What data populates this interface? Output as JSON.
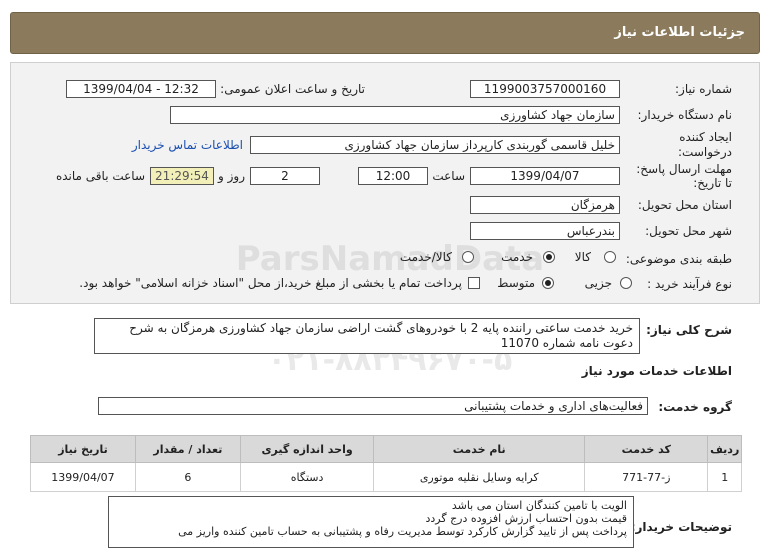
{
  "header": {
    "title": "جزئیات اطلاعات نیاز"
  },
  "form": {
    "need_number_label": "شماره نیاز:",
    "need_number": "1199003757000160",
    "announce_label": "تاریخ و ساعت اعلان عمومی:",
    "announce_value": "1399/04/04 - 12:32",
    "buyer_org_label": "نام دستگاه خریدار:",
    "buyer_org": "سازمان جهاد کشاورزی",
    "creator_label_1": "ایجاد کننده",
    "creator_label_2": "درخواست:",
    "creator": "خلیل قاسمی گوربندی کارپرداز سازمان جهاد کشاورزی",
    "contact_link": "اطلاعات تماس خریدار",
    "deadline_label_1": "مهلت ارسال پاسخ:",
    "deadline_label_2": "تا تاریخ:",
    "deadline_date": "1399/04/07",
    "time_label": "ساعت",
    "deadline_time": "12:00",
    "days_value": "2",
    "days_label": "روز و",
    "remaining_value": "21:29:54",
    "remaining_label": "ساعت باقی مانده",
    "province_label": "استان محل تحویل:",
    "province": "هرمزگان",
    "city_label": "شهر محل تحویل:",
    "city": "بندرعباس",
    "category_label": "طبقه بندی موضوعی:",
    "category_options": [
      "کالا",
      "خدمت",
      "کالا/خدمت"
    ],
    "category_selected": "خدمت",
    "process_label": "نوع فرآیند خرید :",
    "process_options": [
      "جزیی",
      "متوسط"
    ],
    "process_selected": "متوسط",
    "payment_note": "پرداخت تمام یا بخشی از مبلغ خرید،از محل \"اسناد خزانه اسلامی\" خواهد بود."
  },
  "description": {
    "label": "شرح کلی نیاز:",
    "text": "خرید خدمت ساعتی راننده پایه 2 با خودروهای گشت اراضی سازمان جهاد کشاورزی هرمزگان به شرح دعوت نامه شماره 11070"
  },
  "services": {
    "section_title": "اطلاعات خدمات مورد نیاز",
    "group_label": "گروه خدمت:",
    "group_value": "فعالیت‌های اداری و خدمات پشتیبانی",
    "columns": [
      "ردیف",
      "کد خدمت",
      "نام خدمت",
      "واحد اندازه گیری",
      "تعداد / مقدار",
      "تاریخ نیاز"
    ],
    "rows": [
      {
        "row": "1",
        "code": "ز-77-771",
        "name": "کرایه وسایل نقلیه موتوری",
        "unit": "دستگاه",
        "qty": "6",
        "date": "1399/04/07"
      }
    ]
  },
  "notes": {
    "label": "توضیحات خریدار:",
    "lines": [
      "الویت با تامین کنندگان استان می باشد",
      "قیمت بدون احتساب ارزش افزوده درج گردد",
      "پرداخت پس از تایید گزارش کارکرد  توسط مدیریت رفاه و پشتیبانی  به حساب تامین کننده واریز می"
    ]
  },
  "watermark": {
    "brand": "ParsNamadData",
    "phone": "۰۲۱-۸۸۳۴۹۶۷۰-۵"
  }
}
